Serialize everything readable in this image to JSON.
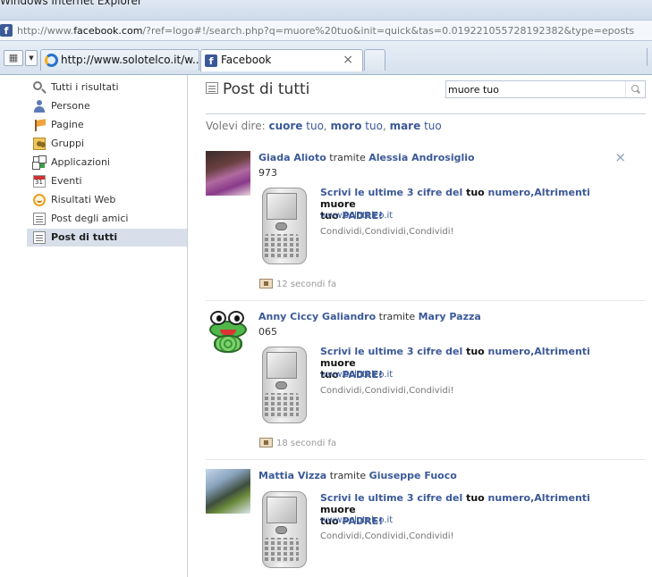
{
  "window_title": "Windows Internet Explorer",
  "address": {
    "prefix": "http://www.",
    "domain": "facebook.com",
    "rest": "/?ref=logo#!/search.php?q=muore%20tuo&init=quick&tas=0.019221055728192382&type=eposts"
  },
  "tabs": [
    {
      "label": "http://www.solotelco.it/w...",
      "icon": "ie-icon"
    },
    {
      "label": "Facebook",
      "icon": "facebook-icon",
      "close": "×"
    }
  ],
  "sidebar": {
    "items": [
      {
        "label": "Tutti i risultati",
        "icon": "search-icon"
      },
      {
        "label": "Persone",
        "icon": "person-icon"
      },
      {
        "label": "Pagine",
        "icon": "flag-icon"
      },
      {
        "label": "Gruppi",
        "icon": "group-icon"
      },
      {
        "label": "Applicazioni",
        "icon": "apps-icon"
      },
      {
        "label": "Eventi",
        "icon": "calendar-icon"
      },
      {
        "label": "Risultati Web",
        "icon": "web-icon"
      },
      {
        "label": "Post degli amici",
        "icon": "list-icon"
      },
      {
        "label": "Post di tutti",
        "icon": "list-icon",
        "selected": true
      }
    ]
  },
  "main": {
    "title": "Post di tutti",
    "search": {
      "value": "muore tuo",
      "placeholder": ""
    },
    "suggest": {
      "prefix": "Volevi dire:",
      "items": [
        {
          "bold": "cuore",
          "rest": " tuo",
          "sep": ", "
        },
        {
          "bold": "moro",
          "rest": " tuo",
          "sep": ", "
        },
        {
          "bold": "mare",
          "rest": " tuo",
          "sep": ""
        }
      ]
    }
  },
  "posts": [
    {
      "author": "Giada Alioto",
      "via": "tramite",
      "via_author": "Alessia Androsiglio",
      "message": "973",
      "link": {
        "t1": "Scrivi le ultime 3 cifre del ",
        "h1": "tuo",
        "t2": " numero,Altrimenti ",
        "h2": "muore",
        "t3": "",
        "h3": "tuo",
        "t4": " PADRE!",
        "url": "www.solotelco.it",
        "desc": "Condividi,Condividi,Condividi!"
      },
      "time": "12 secondi fa"
    },
    {
      "author": "Anny Ciccy Galiandro",
      "via": "tramite",
      "via_author": "Mary Pazza",
      "message": "065",
      "link": {
        "t1": "Scrivi le ultime 3 cifre del ",
        "h1": "tuo",
        "t2": " numero,Altrimenti ",
        "h2": "muore",
        "t3": "",
        "h3": "tuo",
        "t4": " PADRE!",
        "url": "www.solotelco.it",
        "desc": "Condividi,Condividi,Condividi!"
      },
      "time": "18 secondi fa"
    },
    {
      "author": "Mattia Vizza",
      "via": "tramite",
      "via_author": "Giuseppe Fuoco",
      "message": "",
      "link": {
        "t1": "Scrivi le ultime 3 cifre del ",
        "h1": "tuo",
        "t2": " numero,Altrimenti ",
        "h2": "muore",
        "t3": "",
        "h3": "tuo",
        "t4": " PADRE!",
        "url": "www.solotelco.it",
        "desc": "Condividi,Condividi,Condividi!"
      },
      "time": ""
    }
  ],
  "colors": {
    "link": "#3b5998",
    "selected_bg": "#d8dfea",
    "text": "#333333"
  }
}
